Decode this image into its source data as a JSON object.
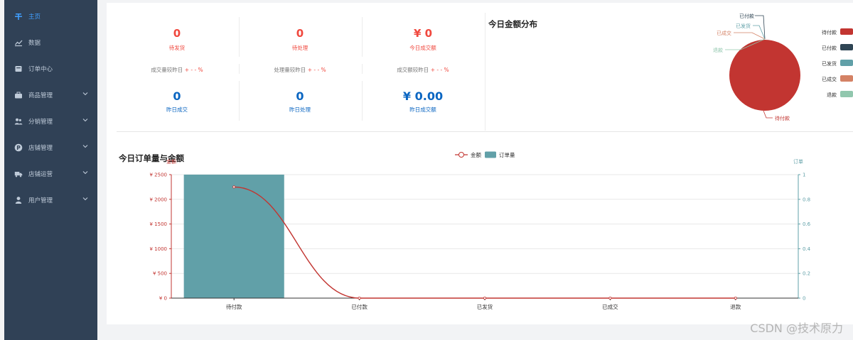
{
  "sidebar": {
    "items": [
      {
        "label": "主页",
        "icon": "home-icon",
        "active": true,
        "expandable": false
      },
      {
        "label": "数据",
        "icon": "line-chart-icon",
        "active": false,
        "expandable": false
      },
      {
        "label": "订单中心",
        "icon": "inbox-icon",
        "active": false,
        "expandable": false
      },
      {
        "label": "商品管理",
        "icon": "briefcase-icon",
        "active": false,
        "expandable": true
      },
      {
        "label": "分销管理",
        "icon": "users-icon",
        "active": false,
        "expandable": true
      },
      {
        "label": "店铺管理",
        "icon": "parking-icon",
        "active": false,
        "expandable": true
      },
      {
        "label": "店铺运营",
        "icon": "truck-icon",
        "active": false,
        "expandable": true
      },
      {
        "label": "用户管理",
        "icon": "user-icon",
        "active": false,
        "expandable": true
      }
    ]
  },
  "stats": {
    "pending_ship": {
      "value": "0",
      "label": "待发货"
    },
    "pending_process": {
      "value": "0",
      "label": "待处理"
    },
    "today_amount": {
      "value": "¥ 0",
      "label": "今日成交额"
    },
    "cmp_volume": {
      "text": "成交量较昨日",
      "sign": "+ - - %"
    },
    "cmp_process": {
      "text": "处理量较昨日",
      "sign": "+ - - %"
    },
    "cmp_amount": {
      "text": "成交额较昨日",
      "sign": "+ - - %"
    },
    "yesterday_deals": {
      "value": "0",
      "label": "昨日成交"
    },
    "yesterday_process": {
      "value": "0",
      "label": "昨日处理"
    },
    "yesterday_amount": {
      "value": "¥ 0.00",
      "label": "昨日成交额"
    }
  },
  "pie_title": "今日金额分布",
  "line_title": "今日订单量与金额",
  "watermark": "CSDN @技术原力",
  "colors": {
    "sidebar_bg": "#304156",
    "active": "#409eff",
    "red": "#f0483e",
    "blue": "#0b66c2",
    "pie_red": "#c23531",
    "dark": "#2f4554",
    "teal": "#61a0a8",
    "orange": "#d48265",
    "green": "#91c7ae"
  },
  "chart_data": [
    {
      "type": "pie",
      "title": "今日金额分布",
      "categories": [
        "待付款",
        "已付款",
        "已发货",
        "已成交",
        "退款"
      ],
      "values": [
        1,
        0,
        0,
        0,
        0
      ],
      "legend": {
        "placement": "right",
        "entries": [
          "待付款",
          "已付款",
          "已发货",
          "已成交",
          "退款"
        ]
      }
    },
    {
      "type": "bar",
      "title": "今日订单量与金额",
      "categories": [
        "待付款",
        "已付款",
        "已发货",
        "已成交",
        "退款"
      ],
      "legend": {
        "placement": "top-center",
        "entries": [
          "金额",
          "订单量"
        ]
      },
      "series": [
        {
          "name": "金额",
          "type": "line",
          "axis": "left",
          "values": [
            2250,
            0,
            0,
            0,
            0
          ]
        },
        {
          "name": "订单量",
          "type": "bar",
          "axis": "right",
          "values": [
            1,
            0,
            0,
            0,
            0
          ]
        }
      ],
      "y_left": {
        "label": "金额",
        "ylim": [
          0,
          2500
        ],
        "ticks": [
          "¥ 0",
          "¥ 500",
          "¥ 1000",
          "¥ 1500",
          "¥ 2000",
          "¥ 2500"
        ]
      },
      "y_right": {
        "label": "订单",
        "ylim": [
          0,
          1
        ],
        "ticks": [
          "0",
          "0.2",
          "0.4",
          "0.6",
          "0.8",
          "1"
        ]
      },
      "grid": true
    }
  ]
}
